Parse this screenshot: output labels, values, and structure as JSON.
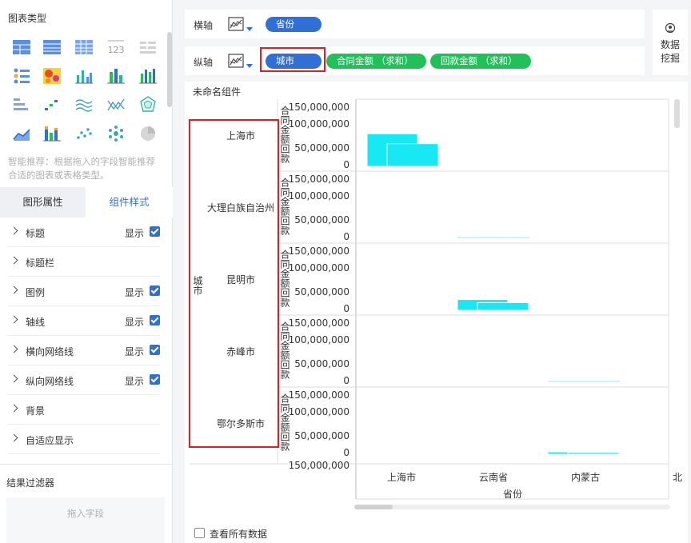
{
  "left_panel": {
    "chart_type_title": "图表类型",
    "smart_hint": "智能推荐：根据拖入的字段智能推荐合适的图表或表格类型。",
    "tabs": {
      "graph_props": "图形属性",
      "component_style": "组件样式"
    },
    "properties": [
      {
        "label": "标题",
        "show": "显示",
        "checkbox": true
      },
      {
        "label": "标题栏",
        "show": "",
        "checkbox": false
      },
      {
        "label": "图例",
        "show": "显示",
        "checkbox": true
      },
      {
        "label": "轴线",
        "show": "显示",
        "checkbox": true
      },
      {
        "label": "横向网络线",
        "show": "显示",
        "checkbox": true
      },
      {
        "label": "纵向网络线",
        "show": "显示",
        "checkbox": true
      },
      {
        "label": "背景",
        "show": "",
        "checkbox": false
      },
      {
        "label": "自适应显示",
        "show": "",
        "checkbox": false
      }
    ],
    "filter_title": "结果过滤器",
    "drop_hint": "拖入字段"
  },
  "axes": {
    "x_label": "横轴",
    "y_label": "纵轴",
    "x_fields": [
      "省份"
    ],
    "y_dimension": "城市",
    "y_measures": [
      "合同金额 （求和）",
      "回款金额 （求和）"
    ]
  },
  "data_mining": "数据挖掘",
  "chart": {
    "component_title": "未命名组件",
    "view_all": "查看所有数据"
  },
  "colors": {
    "accent": "#2f6fd6",
    "green": "#21c05a",
    "bar": "#17e8f4",
    "highlight": "#e51c23"
  },
  "chart_data": {
    "type": "bar",
    "facet_title": "城市",
    "facets": [
      "上海市",
      "大理白族自治州",
      "昆明市",
      "赤峰市",
      "鄂尔多斯市"
    ],
    "categories": [
      "上海市",
      "云南省",
      "内蒙古",
      "北"
    ],
    "xlabel": "省份",
    "ylabel": "合同金额回款",
    "y_ticks": [
      "150,000,000",
      "100,000,000",
      "50,000,000",
      "0"
    ],
    "y_tick_values": [
      150000000,
      100000000,
      50000000,
      0
    ],
    "cut_tick": "150,000,000",
    "ylim": [
      0,
      150000000
    ],
    "series": [
      {
        "values": [
          [
            85000000,
            0,
            0
          ],
          [
            0,
            0,
            0
          ],
          [
            0,
            28000000,
            0
          ],
          [
            0,
            0,
            0
          ],
          [
            0,
            0,
            6000000
          ]
        ]
      },
      {
        "values": [
          [
            59000000,
            0,
            0
          ],
          [
            0,
            0,
            0
          ],
          [
            0,
            20000000,
            0
          ],
          [
            0,
            0,
            0
          ],
          [
            0,
            0,
            4500000
          ]
        ]
      }
    ]
  }
}
